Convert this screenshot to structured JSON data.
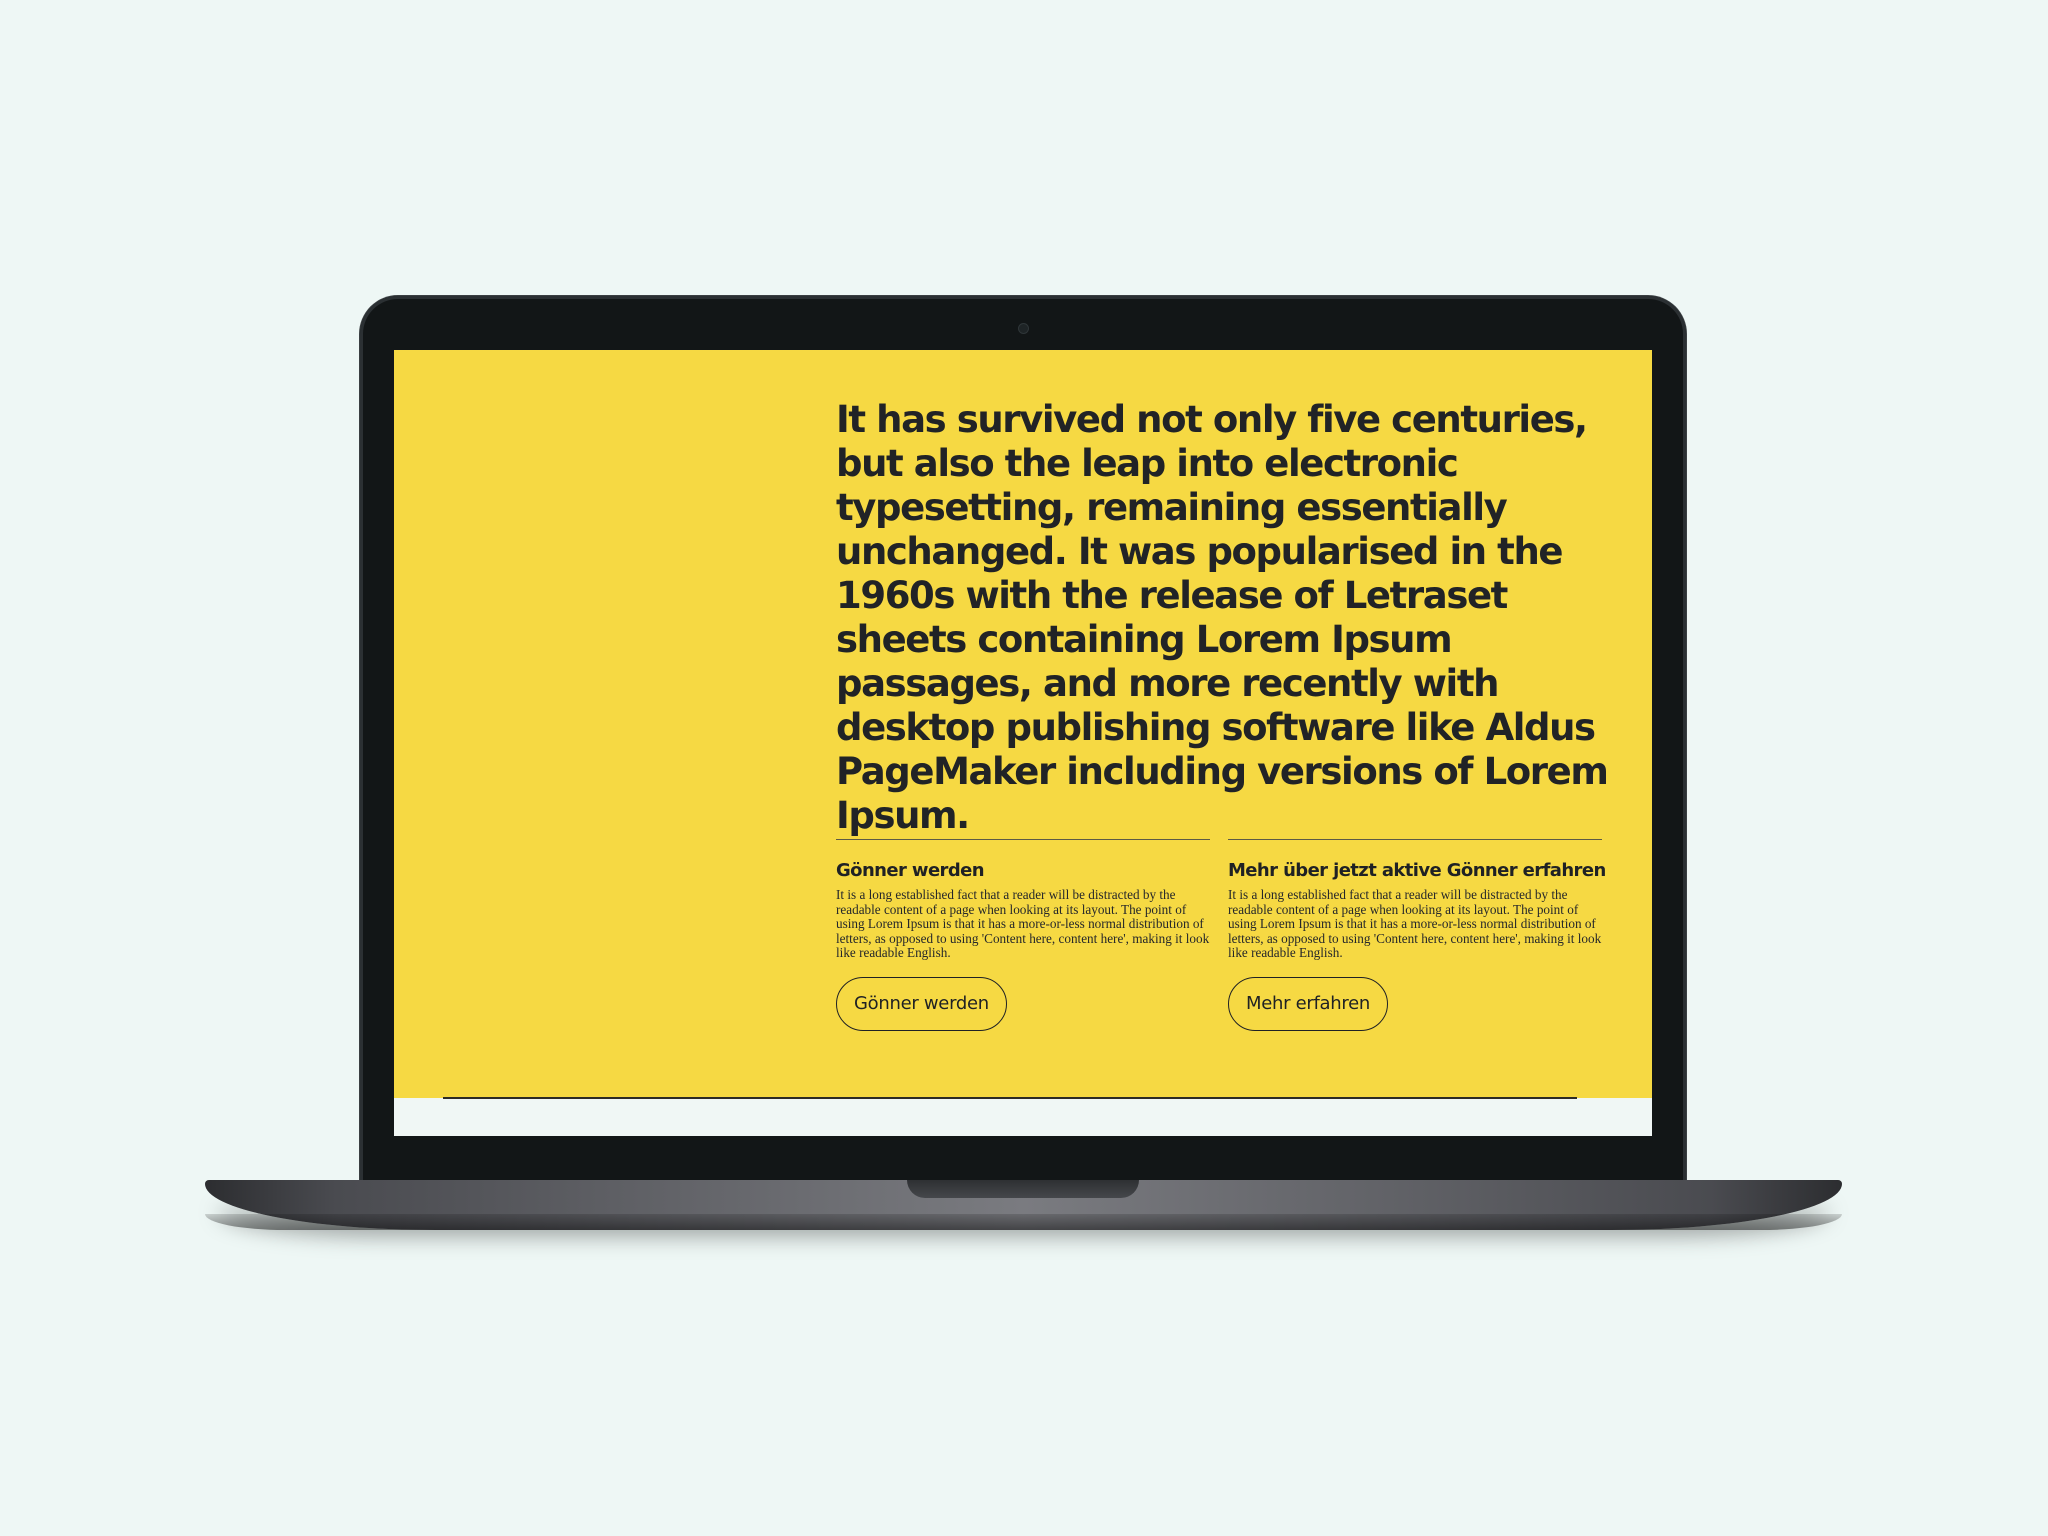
{
  "headline": "It has survived not only five centuries, but also the leap into electronic typesetting, remaining essentially unchanged. It was popularised in the 1960s with the release of Letraset sheets containing Lorem Ipsum passages, and more recently with desktop publishing software like Aldus PageMaker including versions of Lorem Ipsum.",
  "columns": [
    {
      "title": "Gönner werden",
      "text": "It is a long established fact that a reader will be distracted by the readable content of a page when looking at its layout. The point of using Lorem Ipsum is that it has a more-or-less normal distribution of letters, as opposed to using 'Content here, content here', making it look like readable English.",
      "button_label": "Gönner werden"
    },
    {
      "title": "Mehr über jetzt aktive Gönner erfahren",
      "text": "It is a long established fact that a reader will be distracted by the readable content of a page when looking at its layout. The point of using Lorem Ipsum is that it has a more-or-less normal distribution of letters, as opposed to using 'Content here, content here', making it look like readable English.",
      "button_label": "Mehr erfahren"
    }
  ],
  "colors": {
    "page_background": "#eef7f5",
    "panel_yellow": "#f6d943",
    "text_dark": "#212326",
    "device_bezel": "#121617"
  }
}
